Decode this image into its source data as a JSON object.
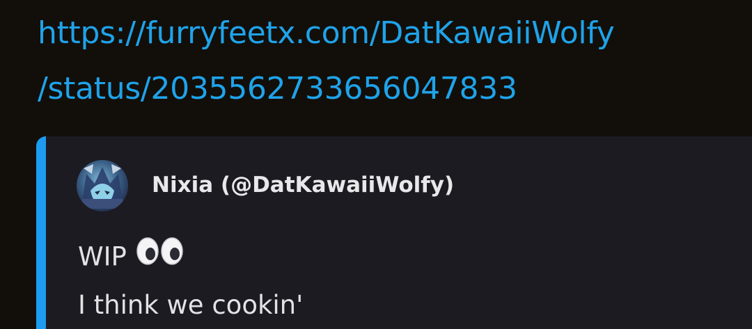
{
  "message": {
    "link_line1": "https://furryfeetx.com/DatKawaiiWolfy",
    "link_line2": "/status/2035562733656047833"
  },
  "embed": {
    "author": "Nixia (@DatKawaiiWolfy)",
    "text_line1": "WIP",
    "emoji": "eyes-emoji",
    "text_line2": "I think we cookin'",
    "accent_color": "#1d9bf0"
  },
  "colors": {
    "background": "#120f0a",
    "link": "#1fa3ea",
    "embed_background": "#1c1b22"
  }
}
